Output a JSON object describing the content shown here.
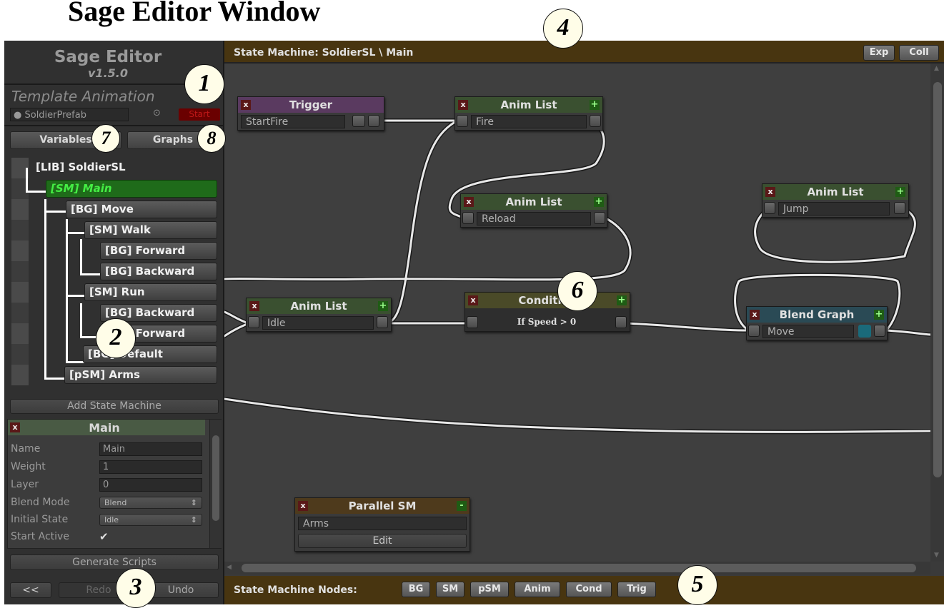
{
  "figure_title": "Sage Editor Window",
  "app": {
    "title": "Sage Editor",
    "version": "v1.5.0",
    "template_label": "Template Animation",
    "prefab_field": "SoldierPrefab",
    "start_button": "Start",
    "tabs": {
      "variables": "Variables",
      "graphs": "Graphs"
    },
    "tree": [
      {
        "label": "[LIB] SoldierSL",
        "selected": false
      },
      {
        "label": "[SM] Main",
        "selected": true
      },
      {
        "label": "[BG] Move",
        "selected": false
      },
      {
        "label": "[SM] Walk",
        "selected": false
      },
      {
        "label": "[BG] Forward",
        "selected": false
      },
      {
        "label": "[BG] Backward",
        "selected": false
      },
      {
        "label": "[SM] Run",
        "selected": false
      },
      {
        "label": "[BG] Backward",
        "selected": false
      },
      {
        "label": "[BG] Forward",
        "selected": false
      },
      {
        "label": "[BG] Default",
        "selected": false
      },
      {
        "label": "[pSM] Arms",
        "selected": false
      }
    ],
    "add_state_machine": "Add State Machine",
    "inspector": {
      "title": "Main",
      "close": "x",
      "fields": [
        {
          "label": "Name",
          "value": "Main",
          "kind": "text"
        },
        {
          "label": "Weight",
          "value": "1",
          "kind": "text"
        },
        {
          "label": "Layer",
          "value": "0",
          "kind": "text"
        },
        {
          "label": "Blend Mode",
          "value": "Blend",
          "kind": "select"
        },
        {
          "label": "Initial State",
          "value": "Idle",
          "kind": "select"
        },
        {
          "label": "Start Active",
          "value": "✔",
          "kind": "checkbox"
        }
      ]
    },
    "generate_scripts": "Generate Scripts",
    "history": {
      "back": "<<",
      "redo": "Redo",
      "undo": "Undo"
    }
  },
  "topbar": {
    "breadcrumb": "State Machine:  SoldierSL \\ Main",
    "expand": "Exp",
    "collapse": "Coll"
  },
  "nodes": {
    "trigger": {
      "title": "Trigger",
      "field": "StartFire"
    },
    "anim_fire": {
      "title": "Anim List",
      "field": "Fire"
    },
    "anim_reload": {
      "title": "Anim List",
      "field": "Reload"
    },
    "anim_jump": {
      "title": "Anim List",
      "field": "Jump"
    },
    "anim_idle": {
      "title": "Anim List",
      "field": "Idle"
    },
    "condition": {
      "title": "Condition",
      "field": "If Speed > 0"
    },
    "blend_graph": {
      "title": "Blend Graph",
      "field": "Move"
    },
    "parallel_sm": {
      "title": "Parallel SM",
      "field": "Arms",
      "button": "Edit",
      "toggle": "-"
    },
    "close": "x",
    "add": "+"
  },
  "bottombar": {
    "label": "State Machine Nodes:",
    "buttons": [
      "BG",
      "SM",
      "pSM",
      "Anim",
      "Cond",
      "Trig"
    ]
  },
  "callouts": [
    "1",
    "2",
    "3",
    "4",
    "5",
    "6",
    "7",
    "8"
  ],
  "colors": {
    "bar_brown": "#483510",
    "selected_green": "#1f6b1a",
    "trigger_header": "#5a3a60",
    "anim_header": "#3a5030",
    "condition_header": "#4a4a28",
    "blend_header": "#2a4a55",
    "parallel_header": "#4e3a1c"
  }
}
